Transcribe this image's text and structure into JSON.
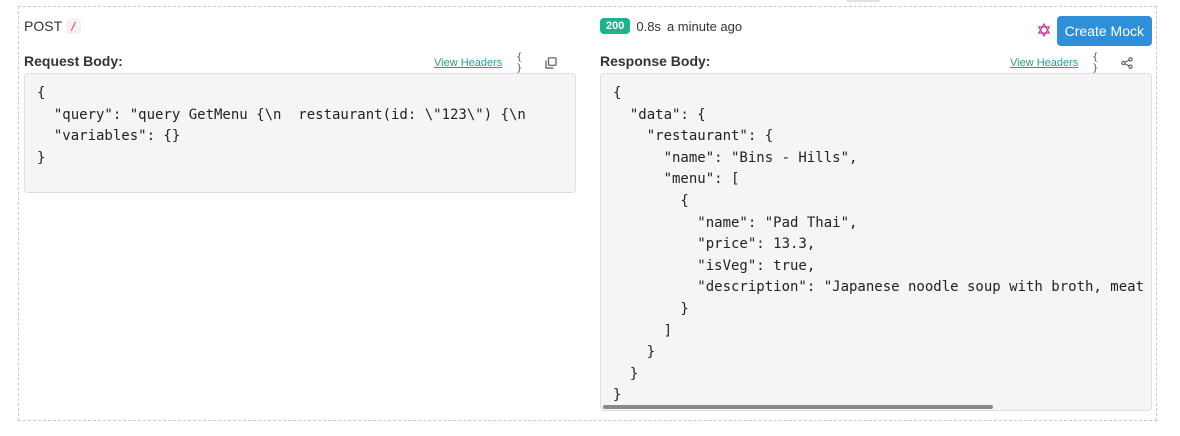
{
  "request": {
    "method": "POST",
    "path": "/",
    "section_title": "Request Body:",
    "view_headers": "View Headers",
    "format_icon": "{ }",
    "body": "{\n  \"query\": \"query GetMenu {\\n  restaurant(id: \\\"123\\\") {\\n    \n  \"variables\": {}\n}"
  },
  "response": {
    "status_code": "200",
    "duration": "0.8s",
    "time_ago": "a minute ago",
    "section_title": "Response Body:",
    "view_headers": "View Headers",
    "format_icon": "{ }",
    "body": "{\n  \"data\": {\n    \"restaurant\": {\n      \"name\": \"Bins - Hills\",\n      \"menu\": [\n        {\n          \"name\": \"Pad Thai\",\n          \"price\": 13.3,\n          \"isVeg\": true,\n          \"description\": \"Japanese noodle soup with broth, meat\n        }\n      ]\n    }\n  }\n}"
  },
  "actions": {
    "create_mock": "Create Mock"
  },
  "icons": {
    "copy": "copy-icon",
    "share": "share-icon",
    "mock": "star-of-david-icon"
  }
}
